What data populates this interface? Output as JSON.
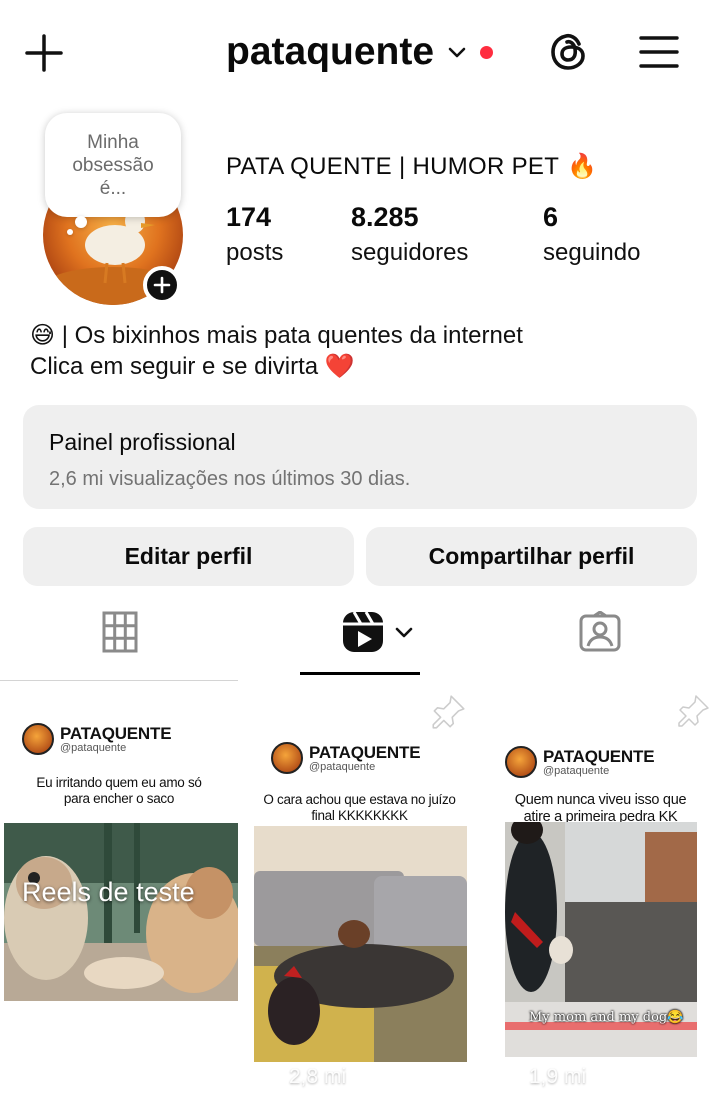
{
  "header": {
    "username": "pataquente",
    "icons": {
      "add": "plus-icon",
      "switch": "chevron-down-icon",
      "threads": "threads-icon",
      "menu": "hamburger-icon"
    },
    "notification_color": "#ff2d3f"
  },
  "profile": {
    "note_text_line1": "Minha",
    "note_text_line2": "obsessão",
    "note_text_line3": "é...",
    "display_name": "PATA QUENTE | HUMOR PET",
    "display_name_emoji": "🔥",
    "stats": [
      {
        "value": "174",
        "label": "posts"
      },
      {
        "value": "8.285",
        "label": "seguidores"
      },
      {
        "value": "6",
        "label": "seguindo"
      }
    ],
    "bio_line1": "😅 | Os bixinhos mais pata quentes da internet",
    "bio_line2": "Clica em seguir e se divirta ❤️"
  },
  "panel": {
    "title": "Painel profissional",
    "subtitle": "2,6 mi visualizações nos últimos 30 dias."
  },
  "buttons": {
    "edit": "Editar perfil",
    "share": "Compartilhar perfil"
  },
  "tabs": {
    "active": "reels",
    "items": [
      "grid-icon",
      "reels-icon",
      "tagged-icon"
    ]
  },
  "grid": {
    "tiles": [
      {
        "brand": "PATAQUENTE",
        "handle": "@pataquente",
        "caption_line1": "Eu irritando quem eu amo só",
        "caption_line2": "para encher o saco",
        "overlay": "Reels de teste"
      },
      {
        "brand": "PATAQUENTE",
        "handle": "@pataquente",
        "caption_line1": "O cara achou que estava no juízo",
        "caption_line2": "final KKKKKKKK",
        "views": "2,8 mi"
      },
      {
        "brand": "PATAQUENTE",
        "handle": "@pataquente",
        "caption_line1": "Quem nunca viveu isso que",
        "caption_line2": "atire a primeira pedra KK",
        "image_caption": "My mom and my dog😂",
        "views": "1,9 mi"
      }
    ]
  }
}
